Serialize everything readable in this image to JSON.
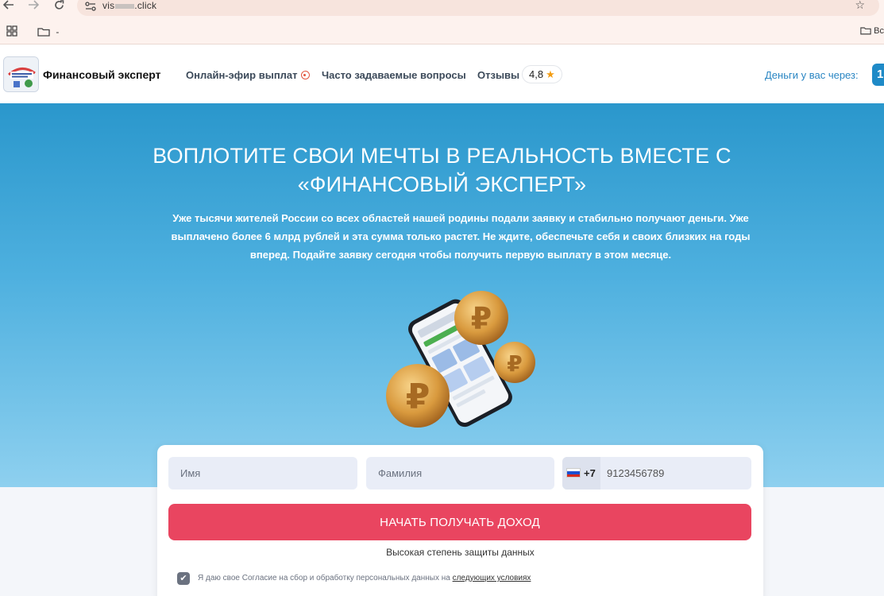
{
  "browser": {
    "url_prefix": "vis",
    "url_suffix": ".click",
    "bookmark_folder": "-",
    "bookmark_right": "Вс"
  },
  "header": {
    "brand": "Финансовый эксперт",
    "nav": {
      "live": "Онлайн-эфир выплат",
      "faq": "Часто задаваемые вопросы",
      "reviews": "Отзывы"
    },
    "rating": "4,8",
    "money_label": "Деньги у вас через:",
    "money_timer": "1"
  },
  "hero": {
    "title": "ВОПЛОТИТЕ СВОИ МЕЧТЫ В РЕАЛЬНОСТЬ ВМЕСТЕ С «ФИНАНСОВЫЙ ЭКСПЕРТ»",
    "subtitle": "Уже тысячи жителей России со всех областей нашей родины подали заявку и стабильно получают деньги. Уже выплачено более 6 млрд рублей и эта сумма только растет. Не ждите, обеспечьте себя и своих близких на годы вперед. Подайте заявку сегодня чтобы получить первую выплату в этом месяце."
  },
  "form": {
    "first_name_placeholder": "Имя",
    "last_name_placeholder": "Фамилия",
    "phone_prefix": "+7",
    "phone_placeholder": "9123456789",
    "submit_label": "НАЧАТЬ ПОЛУЧАТЬ ДОХОД",
    "secure_note": "Высокая степень защиты данных",
    "consent_text": "Я даю свое Согласие на сбор и обработку персональных данных на",
    "consent_link": "следующих условиях",
    "consent_checked": true
  },
  "colors": {
    "accent": "#e94560",
    "hero_top": "#2a97cc",
    "hero_bottom": "#8ed0ef",
    "link_blue": "#2a86c3"
  },
  "icons": [
    "back-arrow-icon",
    "forward-arrow-icon",
    "reload-icon",
    "site-info-icon",
    "bookmark-star-icon",
    "apps-grid-icon",
    "folder-icon",
    "live-indicator-icon",
    "rating-star-icon",
    "russia-flag-icon",
    "checkbox-check-icon"
  ]
}
